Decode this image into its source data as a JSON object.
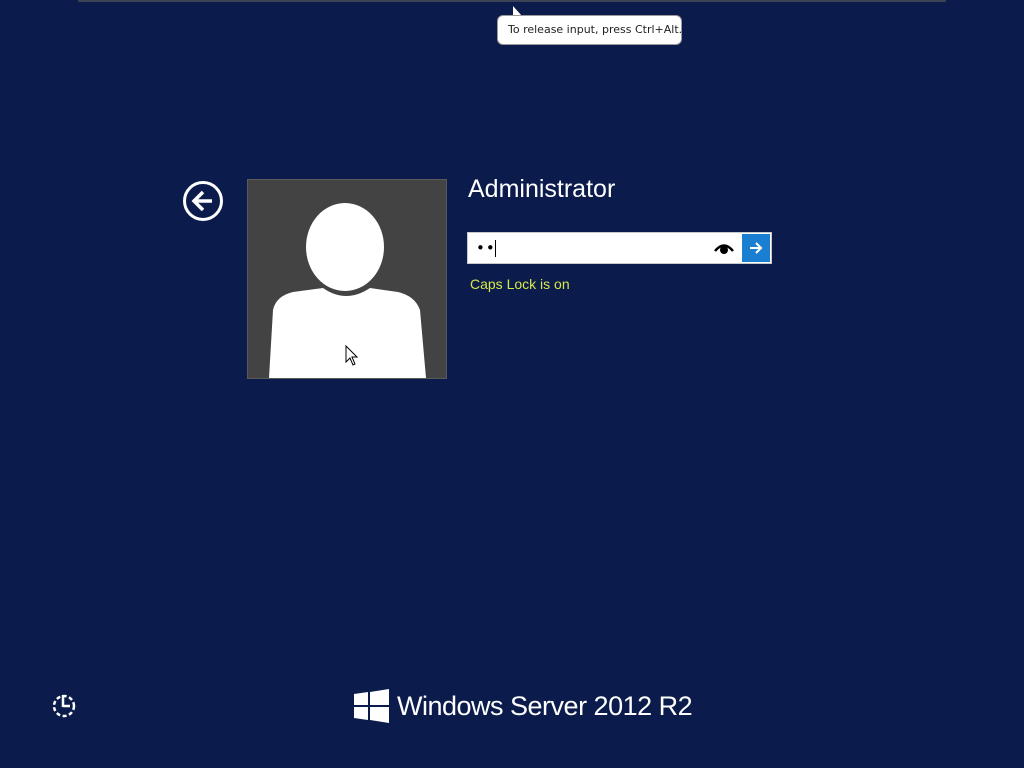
{
  "tooltip": {
    "text": "To release input, press Ctrl+Alt."
  },
  "login": {
    "user_name": "Administrator",
    "password_value": "••",
    "caps_lock_warning": "Caps Lock is on"
  },
  "icons": {
    "back": "back-arrow-icon",
    "avatar": "user-avatar-icon",
    "reveal": "eye-icon",
    "submit": "arrow-right-icon",
    "ease_of_access": "ease-of-access-icon",
    "windows": "windows-logo-icon"
  },
  "branding": {
    "product_name": "Windows Server 2012 R2"
  },
  "colors": {
    "background": "#0b1b4b",
    "submit_button": "#1a7fd0",
    "caps_warning": "#d6e84a",
    "tile": "#434343"
  }
}
